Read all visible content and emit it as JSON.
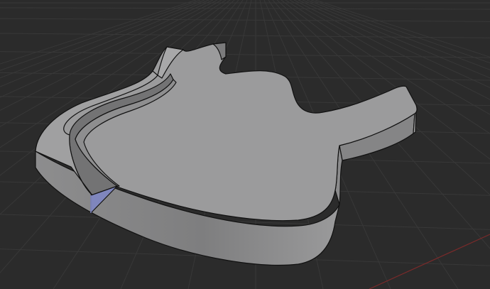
{
  "viewport": {
    "background_color": "#2b2b2b",
    "grid_color": "#383838",
    "axis_color": "#7a2a2a"
  },
  "model": {
    "top_face_color": "#9b9b9c",
    "side_face_color": "#8a8a8b",
    "groove_wall_color": "#6f6f70",
    "edge_color": "#111111",
    "selected_face_color": "#7f86bd"
  }
}
